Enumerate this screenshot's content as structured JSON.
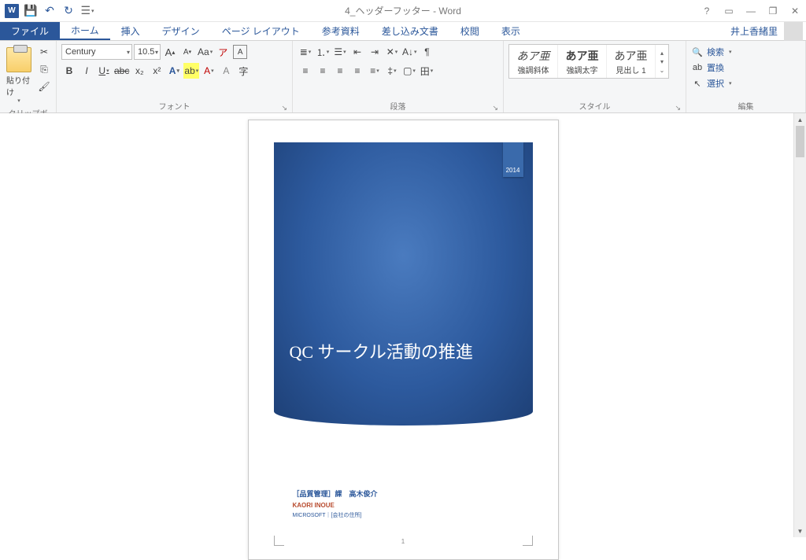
{
  "window": {
    "title": "4_ヘッダーフッター - Word"
  },
  "titlecontrols": {
    "help": "?",
    "ribbonopts": "▭",
    "min": "—",
    "max": "❐",
    "close": "✕"
  },
  "tabs": {
    "file": "ファイル",
    "items": [
      "ホーム",
      "挿入",
      "デザイン",
      "ページ レイアウト",
      "参考資料",
      "差し込み文書",
      "校閲",
      "表示"
    ],
    "user": "井上香緒里"
  },
  "ribbon": {
    "clipboard": {
      "label": "クリップボード",
      "paste": "貼り付け"
    },
    "font": {
      "label": "フォント",
      "name": "Century",
      "size": "10.5",
      "buttons": {
        "bold": "B",
        "italic": "I",
        "underline": "U",
        "strike": "abc",
        "sub": "x₂",
        "sup": "x²",
        "grow": "A",
        "shrink": "A",
        "case": "Aa",
        "clear": "A",
        "phon": "ア",
        "charborder": "A",
        "fontcolor": "A",
        "highlight": "A",
        "charshade": "A",
        "enclosed": "字"
      }
    },
    "paragraph": {
      "label": "段落"
    },
    "styles": {
      "label": "スタイル",
      "items": [
        {
          "preview": "あア亜",
          "name": "強調斜体"
        },
        {
          "preview": "あア亜",
          "name": "強調太字"
        },
        {
          "preview": "あア亜",
          "name": "見出し 1"
        }
      ]
    },
    "editing": {
      "label": "編集",
      "find": "検索",
      "replace": "置換",
      "select": "選択"
    }
  },
  "document": {
    "year": "2014",
    "title": "QC サークル活動の推進",
    "line1": "［品質管理］課　高木俊介",
    "line2": "KAORI INOUE",
    "line3": "MICROSOFT｜[会社の住所]",
    "pagenum": "1"
  }
}
